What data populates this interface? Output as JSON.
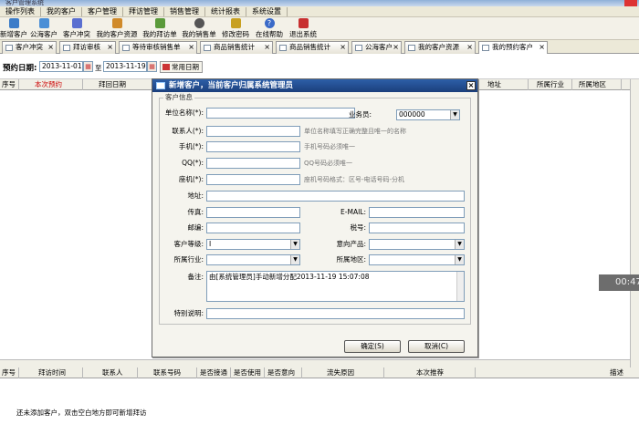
{
  "window": {
    "title": "客户管理系统"
  },
  "menu": [
    "操作列表",
    "我的客户",
    "客户管理",
    "拜访管理",
    "销售管理",
    "统计报表",
    "系统设置"
  ],
  "toolbar": [
    {
      "label": "新增客户",
      "icon": "add-customer-icon",
      "color": "#3c7cc8"
    },
    {
      "label": "公海客户",
      "icon": "public-customers-icon",
      "color": "#4a8fd6"
    },
    {
      "label": "客户冲突",
      "icon": "conflict-icon",
      "color": "#5a6fd0"
    },
    {
      "label": "我的客户资源",
      "icon": "customer-resource-icon",
      "color": "#d08a2a"
    },
    {
      "label": "我的拜访单",
      "icon": "visit-icon",
      "color": "#5a9a3a"
    },
    {
      "label": "我的销售单",
      "icon": "phone-icon",
      "color": "#555"
    },
    {
      "label": "修改密码",
      "icon": "key-icon",
      "color": "#c8a020"
    },
    {
      "label": "在线帮助",
      "icon": "help-icon",
      "color": "#3a6ac8"
    },
    {
      "label": "退出系统",
      "icon": "exit-icon",
      "color": "#c83030"
    }
  ],
  "tabs": [
    "客户冲突",
    "拜访审核",
    "等待审核销售单",
    "商品销售统计",
    "商品销售统计",
    "公海客户",
    "我的客户资源",
    "我的预约客户"
  ],
  "filter": {
    "label": "预约日期:",
    "start": "2013-11-01",
    "to": "至",
    "end": "2013-11-19",
    "common_dates": "常用日期"
  },
  "table": {
    "headers": [
      "序号",
      "本次预约",
      "拜回日期",
      "地址",
      "所属行业",
      "所属地区"
    ]
  },
  "lower_table": {
    "headers": [
      "序号",
      "拜访时间",
      "联系人",
      "联系号码",
      "是否接通",
      "是否使用",
      "是否意向",
      "流失原因",
      "本次推荐",
      "描述"
    ],
    "empty_text": "还未添加客户，双击空白地方即可新增拜访"
  },
  "clock": "00:47",
  "dialog": {
    "title": "新增客户，当前客户归属系统管理员",
    "close": "×",
    "legend": "客户信息",
    "fields": {
      "company_label": "单位名称(*):",
      "company_value": "",
      "salesman_label": "业务员:",
      "salesman_value": "000000",
      "contact_label": "联系人(*):",
      "contact_hint": "单位名称填写正确完整且唯一的名称",
      "mobile_label": "手机(*):",
      "mobile_hint": "手机号码必须唯一",
      "qq_label": "QQ(*):",
      "qq_hint": "QQ号码必须唯一",
      "landline_label": "座机(*):",
      "landline_hint": "座机号码格式：区号-电话号码-分机",
      "address_label": "地址:",
      "fax_label": "传真:",
      "email_label": "E-MAIL:",
      "postcode_label": "邮编:",
      "taxno_label": "税号:",
      "level_label": "客户等级:",
      "level_value": "I",
      "product_label": "意向产品:",
      "industry_label": "所属行业:",
      "region_label": "所属地区:",
      "remark_label": "备注:",
      "remark_value": "由[系统管理员]手动新增分配2013-11-19 15:07:08",
      "special_label": "特别说明:"
    },
    "ok": "确定(S)",
    "cancel": "取消(C)"
  }
}
